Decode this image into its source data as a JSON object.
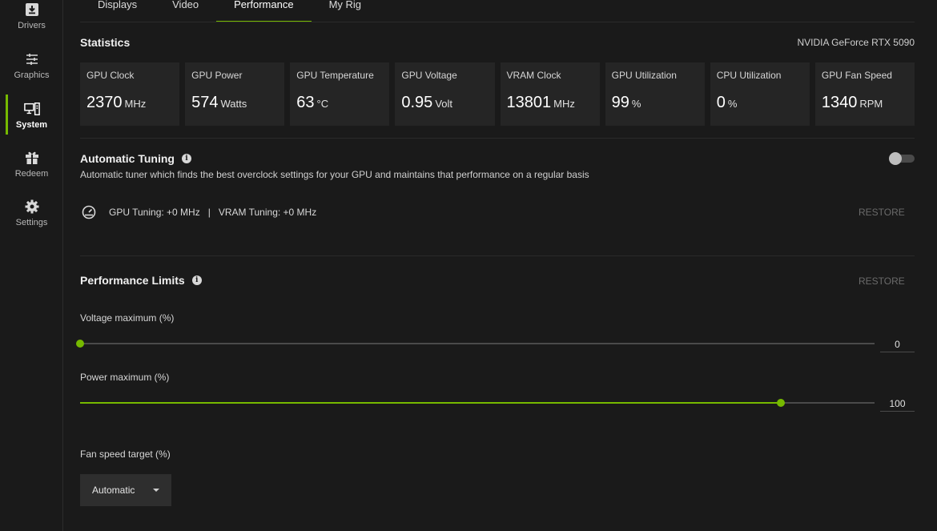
{
  "sidebar": {
    "items": [
      {
        "label": "Drivers",
        "icon": "download-icon"
      },
      {
        "label": "Graphics",
        "icon": "sliders-icon"
      },
      {
        "label": "System",
        "icon": "system-icon",
        "active": true
      },
      {
        "label": "Redeem",
        "icon": "gift-icon"
      },
      {
        "label": "Settings",
        "icon": "gear-icon"
      }
    ],
    "accent": "#76b900"
  },
  "tabs": [
    {
      "label": "Displays"
    },
    {
      "label": "Video"
    },
    {
      "label": "Performance",
      "active": true
    },
    {
      "label": "My Rig"
    }
  ],
  "statistics": {
    "title": "Statistics",
    "gpu_name": "NVIDIA GeForce RTX 5090",
    "cards": [
      {
        "label": "GPU Clock",
        "value": "2370",
        "unit": "MHz"
      },
      {
        "label": "GPU Power",
        "value": "574",
        "unit": "Watts"
      },
      {
        "label": "GPU Temperature",
        "value": "63",
        "unit": "°C"
      },
      {
        "label": "GPU Voltage",
        "value": "0.95",
        "unit": "Volt"
      },
      {
        "label": "VRAM Clock",
        "value": "13801",
        "unit": "MHz"
      },
      {
        "label": "GPU Utilization",
        "value": "99",
        "unit": "%"
      },
      {
        "label": "CPU Utilization",
        "value": "0",
        "unit": "%"
      },
      {
        "label": "GPU Fan Speed",
        "value": "1340",
        "unit": "RPM"
      }
    ]
  },
  "auto_tuning": {
    "title": "Automatic Tuning",
    "description": "Automatic tuner which finds the best overclock settings for your GPU and maintains that performance on a regular basis",
    "enabled": false,
    "status": "GPU Tuning: +0 MHz   |   VRAM Tuning: +0 MHz",
    "restore_label": "RESTORE"
  },
  "performance_limits": {
    "title": "Performance Limits",
    "restore_label": "RESTORE",
    "voltage": {
      "label": "Voltage maximum (%)",
      "value": "0",
      "fraction": 0.0
    },
    "power": {
      "label": "Power maximum (%)",
      "value": "100",
      "fraction": 0.882
    },
    "fan": {
      "label": "Fan speed target (%)",
      "selected": "Automatic"
    }
  }
}
